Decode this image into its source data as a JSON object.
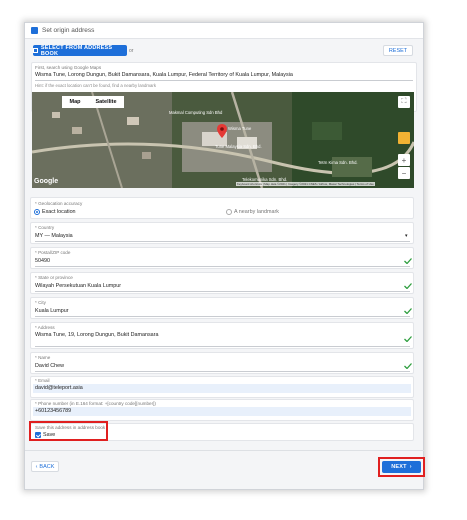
{
  "header": {
    "title": "Set origin address"
  },
  "address_book": {
    "select_label": "SELECT FROM ADDRESS BOOK",
    "or": "or",
    "reset_label": "RESET"
  },
  "search": {
    "label": "First, search using Google Maps",
    "value": "Wisma Tune, Lorong Dungun, Bukit Damansara, Kuala Lumpur, Federal Territory of Kuala Lumpur, Malaysia",
    "hint": "Hint: if the exact location can't be found, find a nearby landmark"
  },
  "map": {
    "tab_map": "Map",
    "tab_satellite": "Satellite",
    "places": [
      "Makmal Computing Sdn Bhd",
      "Wisma Tune",
      "Tune Malaysia Sdn. Bhd.",
      "Telekomunika Sdn. Bhd.",
      "Tetrn Kima Sdn. Bhd."
    ],
    "logo": "Google",
    "attribution": "Keyboard shortcuts  |  Map data ©2021  |  Imagery ©2021 CNES / Airbus, Maxar Technologies  |  Terms of Use",
    "zoom_in": "+",
    "zoom_out": "−"
  },
  "accuracy": {
    "label": "* Geolocation accuracy",
    "exact": "Exact location",
    "landmark": "A nearby landmark"
  },
  "country": {
    "label": "* Country",
    "value": "MY — Malaysia"
  },
  "postal": {
    "label": "* Postal/ZIP code",
    "value": "50490"
  },
  "state": {
    "label": "* State or province",
    "value": "Wilayah Persekutuan Kuala Lumpur"
  },
  "city": {
    "label": "* City",
    "value": "Kuala Lumpur"
  },
  "address": {
    "label": "* Address",
    "value": "Wisma Tune, 19, Lorong Dungun, Bukit Damansara"
  },
  "name": {
    "label": "* Name",
    "value": "David Chew"
  },
  "email": {
    "label": "* Email",
    "value": "david@teleport.asia"
  },
  "phone": {
    "label": "* Phone number (in E.164 format: +[country code][number])",
    "value": "+60123456789"
  },
  "save": {
    "label": "Save this address in address book",
    "checkbox_label": "Save"
  },
  "footer": {
    "back_label": "BACK",
    "next_label": "NEXT"
  },
  "colors": {
    "accent": "#1e6fd9",
    "highlight": "#e02020",
    "success": "#2e9e3e"
  }
}
